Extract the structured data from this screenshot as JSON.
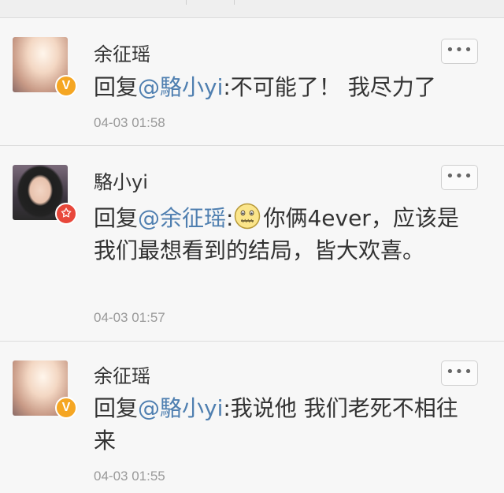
{
  "comments": [
    {
      "username": "余征瑶",
      "reply_prefix": "回复",
      "mention": "@駱小yi",
      "text": ":不可能了！ 我尽力了",
      "timestamp": "04-03 01:58",
      "badge": "V",
      "more_label": "•••"
    },
    {
      "username": "駱小yi",
      "reply_prefix": "回复",
      "mention": "@余征瑶",
      "colon": ":",
      "emoji": "zipper-mouth-emoji",
      "text": "你俩4ever，应该是我们最想看到的结局，皆大欢喜。",
      "timestamp": "04-03 01:57",
      "badge": "✩",
      "more_label": "•••"
    },
    {
      "username": "余征瑶",
      "reply_prefix": "回复",
      "mention": "@駱小yi",
      "text": ":我说他 我们老死不相往来",
      "timestamp": "04-03 01:55",
      "badge": "V",
      "more_label": "•••"
    }
  ],
  "colors": {
    "mention": "#4f7fb0",
    "timestamp": "#999999",
    "verified_badge": "#f5a623",
    "talent_badge": "#e8473b"
  }
}
